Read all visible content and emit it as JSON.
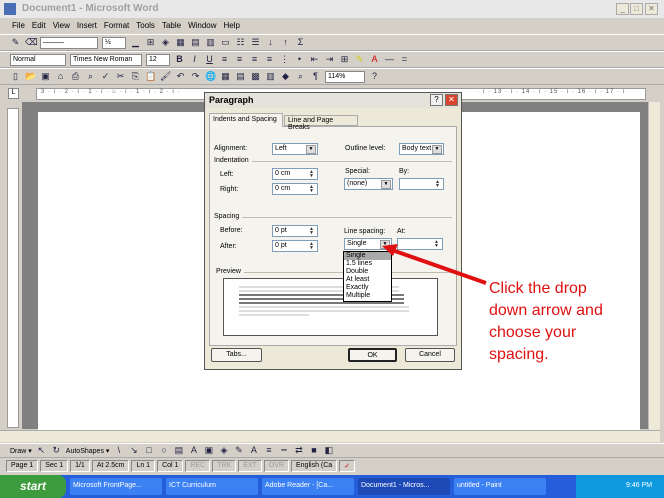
{
  "window": {
    "title": "Document1 - Microsoft Word"
  },
  "menu": [
    "File",
    "Edit",
    "View",
    "Insert",
    "Format",
    "Tools",
    "Table",
    "Window",
    "Help"
  ],
  "formatting": {
    "style": "Normal",
    "font": "Times New Roman",
    "size": "12",
    "zoom": "114%"
  },
  "ruler": {
    "text": "3 · ı · 2 · ı · 1 · ı · ⌂ · ı · 1 · ı · 2 · ı ·",
    "right": "· ı · 13 · ı · 14 · ı · 15 · ı · 16 · ı · 17 · ı"
  },
  "dialog": {
    "title": "Paragraph",
    "tabs": [
      "Indents and Spacing",
      "Line and Page Breaks"
    ],
    "alignment_label": "Alignment:",
    "alignment": "Left",
    "outline_label": "Outline level:",
    "outline": "Body text",
    "indentation_label": "Indentation",
    "left_label": "Left:",
    "left": "0 cm",
    "right_label": "Right:",
    "right": "0 cm",
    "special_label": "Special:",
    "special": "(none)",
    "by_label": "By:",
    "by": "",
    "spacing_label": "Spacing",
    "before_label": "Before:",
    "before": "0 pt",
    "after_label": "After:",
    "after": "0 pt",
    "line_spacing_label": "Line spacing:",
    "line_spacing": "Single",
    "at_label": "At:",
    "at": "",
    "line_spacing_options": [
      "Single",
      "1.5 lines",
      "Double",
      "At least",
      "Exactly",
      "Multiple"
    ],
    "preview_label": "Preview",
    "tabs_button": "Tabs...",
    "ok": "OK",
    "cancel": "Cancel"
  },
  "annotation": [
    "Click the drop",
    "down arrow and",
    "choose your",
    "spacing."
  ],
  "drawing": {
    "draw": "Draw ▾",
    "autoshapes": "AutoShapes ▾"
  },
  "status": [
    "Page 1",
    "Sec 1",
    "1/1",
    "At 2.5cm",
    "Ln 1",
    "Col 1",
    "REC",
    "TRK",
    "EXT",
    "OVR",
    "English (Ca"
  ],
  "taskbar": {
    "start": "start",
    "tasks": [
      "Microsoft FrontPage...",
      "ICT Curriculum",
      "Adobe Reader - [Ca...",
      "Document1 - Micros...",
      "untitled - Paint"
    ],
    "clock": "9:46 PM"
  },
  "colors": {
    "annotation": "#e01010",
    "taskbar": "#245edb"
  }
}
